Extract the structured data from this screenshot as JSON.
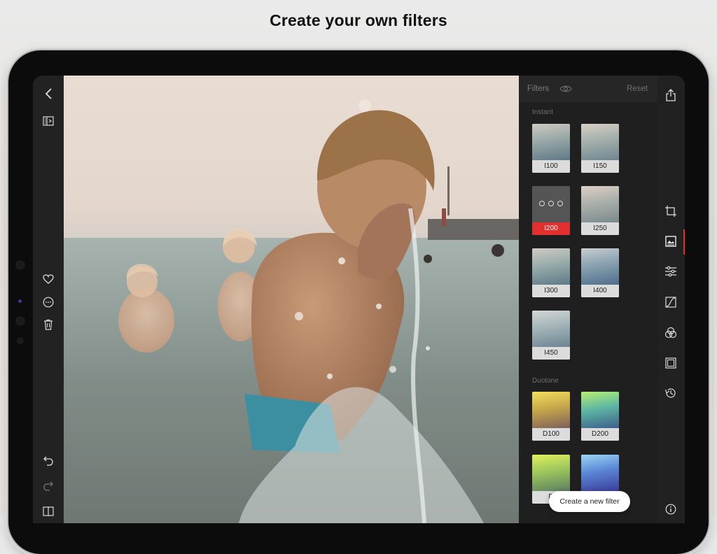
{
  "headline": "Create your own filters",
  "panel": {
    "title": "Filters",
    "reset_label": "Reset",
    "sections": [
      {
        "label": "Instant",
        "filters": [
          "I100",
          "I150",
          "I200",
          "I250",
          "I300",
          "I400",
          "I450"
        ],
        "selected": "I200"
      },
      {
        "label": "Duotone",
        "filters": [
          "D100",
          "D200",
          "D",
          ""
        ]
      }
    ]
  },
  "toast": {
    "label": "Create a new filter"
  },
  "icons": {
    "left_toolbar": [
      "back-arrow-icon",
      "compare-split-icon",
      "heart-icon",
      "more-options-icon",
      "trash-icon",
      "undo-icon",
      "redo-icon",
      "split-view-icon"
    ],
    "right_toolbar": [
      "share-icon",
      "crop-icon",
      "filters-icon",
      "adjust-sliders-icon",
      "curves-icon",
      "color-mix-icon",
      "frame-icon",
      "history-icon",
      "info-icon"
    ],
    "panel_header": [
      "eye-icon"
    ]
  },
  "colors": {
    "accent": "#e1302d",
    "panel_bg": "#1f1f1f",
    "toolbar_bg": "#222222"
  }
}
